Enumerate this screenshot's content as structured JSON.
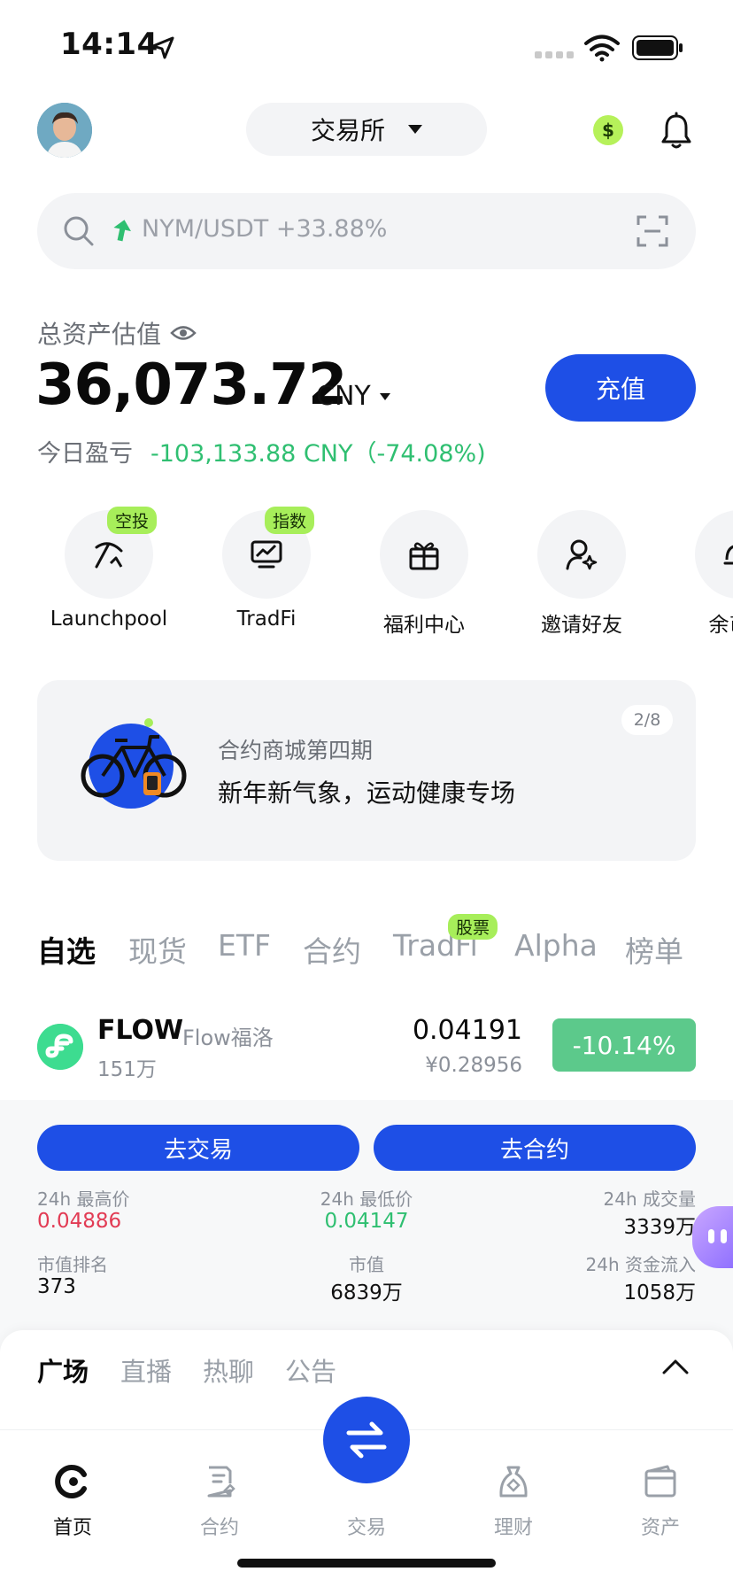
{
  "status_bar": {
    "time": "14:14"
  },
  "header": {
    "exchange_label": "交易所"
  },
  "search": {
    "text": "NYM/USDT +33.88%"
  },
  "assets": {
    "label": "总资产估值",
    "value": "36,073.72",
    "currency": "CNY",
    "pnl_label": "今日盈亏",
    "pnl_value": "-103,133.88 CNY（-74.08%)",
    "deposit_label": "充值"
  },
  "quick_menu": [
    {
      "label": "Launchpool",
      "tag": "空投",
      "icon": "pickaxe-icon"
    },
    {
      "label": "TradFi",
      "tag": "指数",
      "icon": "chart-monitor-icon"
    },
    {
      "label": "福利中心",
      "tag": "",
      "icon": "gift-icon"
    },
    {
      "label": "邀请好友",
      "tag": "",
      "icon": "invite-user-icon"
    },
    {
      "label": "余币宝",
      "tag": "",
      "icon": "savings-icon"
    }
  ],
  "banner": {
    "subtitle": "合约商城第四期",
    "title": "新年新气象，运动健康专场",
    "page": "2/8"
  },
  "market_tabs": [
    "自选",
    "现货",
    "ETF",
    "合约",
    "TradFi",
    "Alpha",
    "榜单"
  ],
  "market_tab_tag": "股票",
  "coin": {
    "symbol": "FLOW",
    "name": "Flow福洛",
    "volume": "151万",
    "price": "0.04191",
    "fiat_price": "¥0.28956",
    "change": "-10.14%"
  },
  "panel": {
    "trade_btn": "去交易",
    "futures_btn": "去合约",
    "stats": {
      "high_label": "24h 最高价",
      "high_value": "0.04886",
      "low_label": "24h 最低价",
      "low_value": "0.04147",
      "volume_label": "24h 成交量",
      "volume_value": "3339万",
      "rank_label": "市值排名",
      "rank_value": "373",
      "mcap_label": "市值",
      "mcap_value": "6839万",
      "inflow_label": "24h 资金流入",
      "inflow_value": "1058万"
    }
  },
  "community_tabs": [
    "广场",
    "直播",
    "热聊",
    "公告"
  ],
  "bottom_nav": [
    {
      "label": "首页",
      "icon": "home-icon"
    },
    {
      "label": "合约",
      "icon": "futures-icon"
    },
    {
      "label": "交易",
      "icon": "swap-icon"
    },
    {
      "label": "理财",
      "icon": "finance-icon"
    },
    {
      "label": "资产",
      "icon": "wallet-icon"
    }
  ],
  "colors": {
    "accent_blue": "#1e4fe6",
    "profit_green": "#2fbf71",
    "loss_red": "#e23b54",
    "tag_lime": "#a7ee5a"
  }
}
